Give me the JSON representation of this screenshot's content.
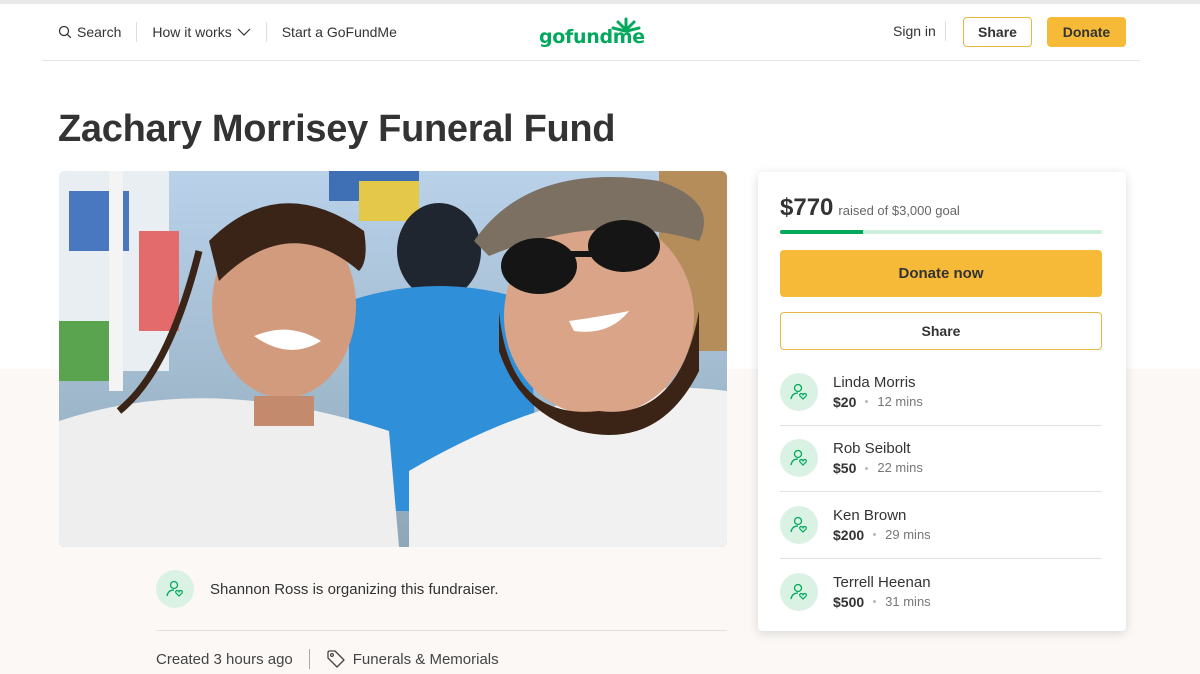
{
  "header": {
    "search_label": "Search",
    "how_it_works_label": "How it works",
    "start_label": "Start a GoFundMe",
    "logo_text": "gofundme",
    "signin_label": "Sign in",
    "share_label": "Share",
    "donate_label": "Donate"
  },
  "campaign": {
    "title": "Zachary Morrisey Funeral Fund",
    "organizer_text": "Shannon Ross is organizing this fundraiser.",
    "created": "Created 3 hours ago",
    "category": "Funerals & Memorials"
  },
  "sidebar": {
    "raised_amount": "$770",
    "raised_goal": "raised of $3,000 goal",
    "progress_fraction": 0.2567,
    "donate_now_label": "Donate now",
    "share_label": "Share",
    "donations": [
      {
        "name": "Linda Morris",
        "amount": "$20",
        "time": "12 mins"
      },
      {
        "name": "Rob Seibolt",
        "amount": "$50",
        "time": "22 mins"
      },
      {
        "name": "Ken Brown",
        "amount": "$200",
        "time": "29 mins"
      },
      {
        "name": "Terrell Heenan",
        "amount": "$500",
        "time": "31 mins"
      }
    ]
  },
  "colors": {
    "brand_green": "#02a95c",
    "donate_yellow": "#f6ba38"
  }
}
